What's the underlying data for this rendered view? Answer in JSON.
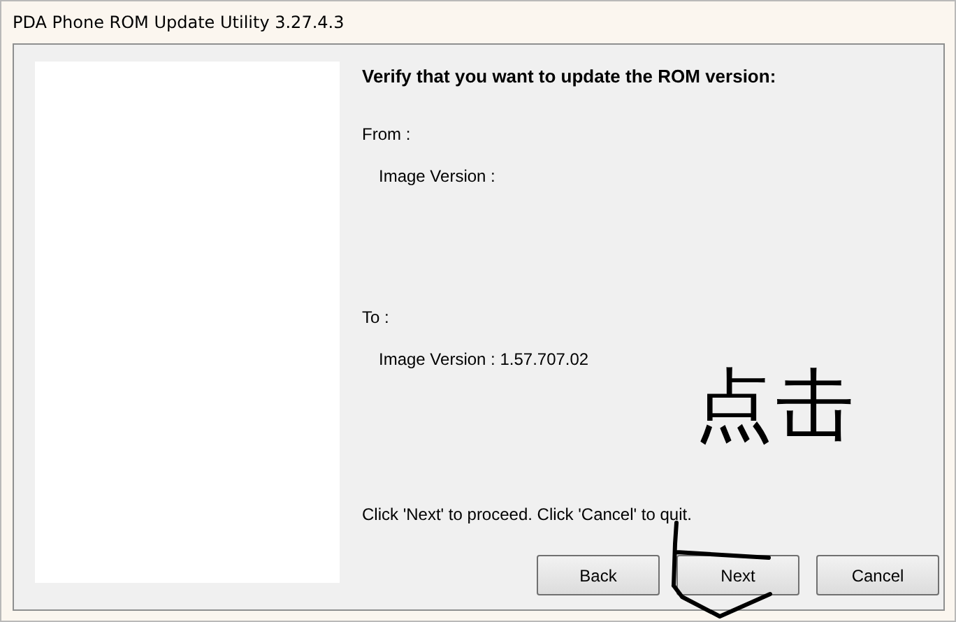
{
  "window": {
    "title": "PDA Phone ROM Update Utility 3.27.4.3"
  },
  "heading": "Verify that you want to update the ROM version:",
  "from": {
    "label": "From :",
    "image_version": "Image Version :"
  },
  "to": {
    "label": "To :",
    "image_version": "Image Version : 1.57.707.02"
  },
  "annotation": "点击",
  "instruction": "Click 'Next' to proceed. Click 'Cancel' to quit.",
  "buttons": [
    "Back",
    "Next",
    "Cancel"
  ]
}
